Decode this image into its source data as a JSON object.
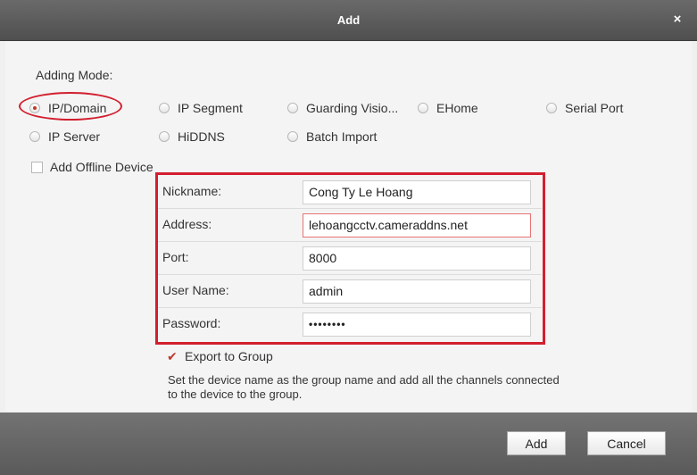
{
  "dialog": {
    "title": "Add",
    "close_glyph": "×"
  },
  "adding_mode": {
    "label": "Adding Mode:",
    "options": [
      {
        "label": "IP/Domain",
        "checked": true
      },
      {
        "label": "IP Segment",
        "checked": false
      },
      {
        "label": "Guarding Visio...",
        "checked": false
      },
      {
        "label": "EHome",
        "checked": false
      },
      {
        "label": "Serial Port",
        "checked": false
      },
      {
        "label": "IP Server",
        "checked": false
      },
      {
        "label": "HiDDNS",
        "checked": false
      },
      {
        "label": "Batch Import",
        "checked": false
      }
    ]
  },
  "offline": {
    "label": "Add Offline Device",
    "checked": false
  },
  "form": {
    "nickname": {
      "label": "Nickname:",
      "value": "Cong Ty Le Hoang"
    },
    "address": {
      "label": "Address:",
      "value": "lehoangcctv.cameraddns.net"
    },
    "port": {
      "label": "Port:",
      "value": "8000"
    },
    "username": {
      "label": "User Name:",
      "value": "admin"
    },
    "password": {
      "label": "Password:",
      "value": "••••••••"
    }
  },
  "export_group": {
    "label": "Export to Group",
    "checked": true,
    "check_glyph": "✔",
    "note": "Set the device name as the group name and add all the channels connected to the device to the group."
  },
  "buttons": {
    "add": "Add",
    "cancel": "Cancel"
  },
  "colors": {
    "accent": "#c0392b",
    "highlight": "#d21f2f",
    "titlebar": "#5a5a5a"
  }
}
